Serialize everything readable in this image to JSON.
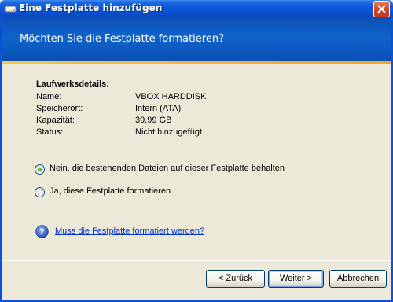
{
  "window": {
    "title": "Eine Festplatte hinzufügen"
  },
  "header": {
    "title": "Möchten Sie die Festplatte formatieren?"
  },
  "details": {
    "heading": "Laufwerksdetails:",
    "rows": [
      {
        "label": "Name:",
        "value": "VBOX HARDDISK"
      },
      {
        "label": "Speicherort:",
        "value": "Intern (ATA)"
      },
      {
        "label": "Kapazität:",
        "value": "39,99 GB"
      },
      {
        "label": "Status:",
        "value": "Nicht hinzugefügt"
      }
    ]
  },
  "options": [
    {
      "label": "Nein, die bestehenden Dateien auf dieser Festplatte behalten",
      "selected": true
    },
    {
      "label": "Ja, diese Festplatte formatieren",
      "selected": false
    }
  ],
  "help": {
    "link_text": "Muss die Festplatte formatiert werden?",
    "icon": "help-icon"
  },
  "buttons": {
    "back_prefix": "< ",
    "back_accel": "Z",
    "back_rest": "urück",
    "next_accel": "W",
    "next_rest": "eiter >",
    "cancel": "Abbrechen"
  },
  "colors": {
    "titlebar": "#0a56d8",
    "header": "#0f63cd",
    "accent_line": "#f1a42b",
    "link": "#0033cc"
  }
}
